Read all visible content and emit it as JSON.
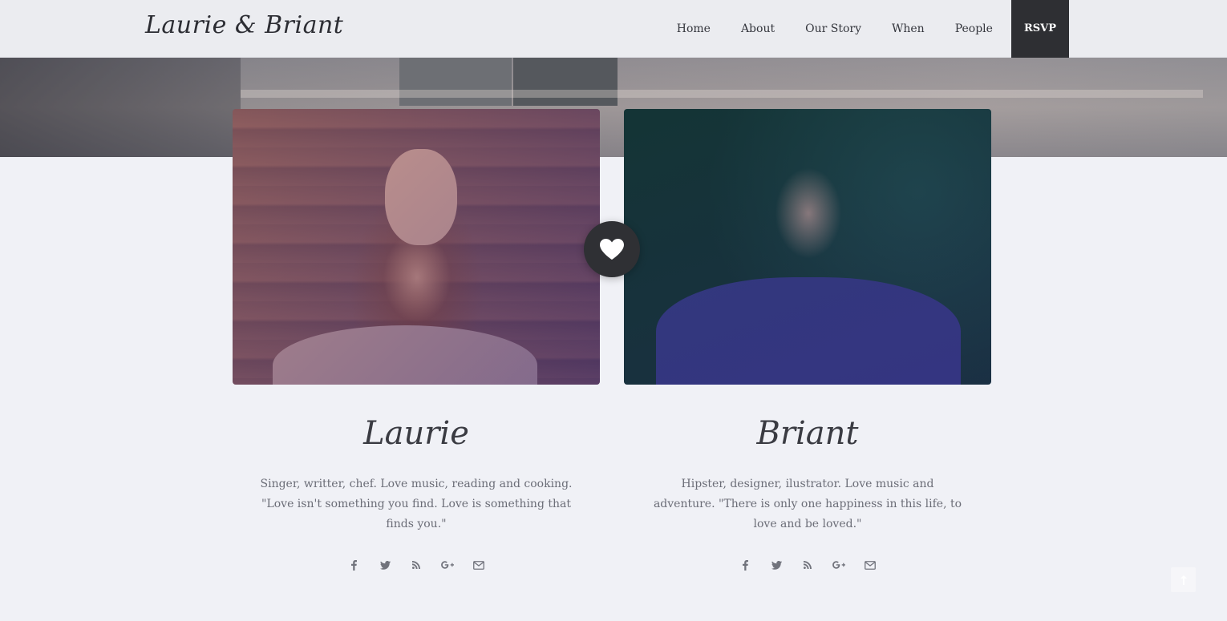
{
  "header": {
    "logo": "Laurie & Briant",
    "nav": [
      "Home",
      "About",
      "Our Story",
      "When",
      "People"
    ],
    "rsvp": "RSVP"
  },
  "couple": {
    "laurie": {
      "name": "Laurie",
      "bio": "Singer, writter, chef. Love music, reading and cooking. \"Love isn't something you find. Love is something that finds you.\"",
      "social": [
        "facebook-icon",
        "twitter-icon",
        "rss-icon",
        "google-plus-icon",
        "envelope-icon"
      ]
    },
    "briant": {
      "name": "Briant",
      "bio": "Hipster, designer, ilustrator. Love music and adventure. \"There is only one happiness in this life, to love and be loved.\"",
      "social": [
        "facebook-icon",
        "twitter-icon",
        "rss-icon",
        "google-plus-icon",
        "envelope-icon"
      ]
    }
  },
  "icons": {
    "heart": "heart-icon",
    "back_to_top": "arrow-up-icon"
  },
  "colors": {
    "background": "#f0f1f6",
    "navbar": "#ebecf0",
    "rsvp_bg": "#2e2f33",
    "heart_badge": "#2f3034"
  }
}
